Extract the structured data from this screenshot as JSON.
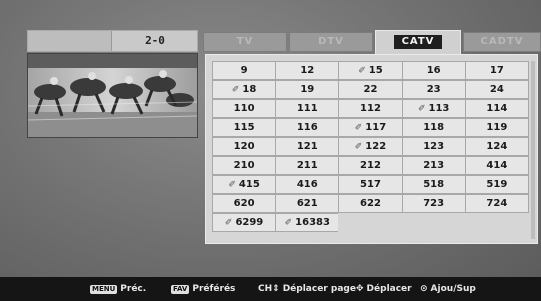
{
  "current_channel": "2-0",
  "tabs": [
    {
      "label": "TV",
      "active": false
    },
    {
      "label": "DTV",
      "active": false
    },
    {
      "label": "CATV",
      "active": true
    },
    {
      "label": "CADTV",
      "active": false
    }
  ],
  "channels": [
    [
      {
        "n": "9",
        "fav": false
      },
      {
        "n": "12",
        "fav": false
      },
      {
        "n": "15",
        "fav": true
      },
      {
        "n": "16",
        "fav": false
      },
      {
        "n": "17",
        "fav": false
      }
    ],
    [
      {
        "n": "18",
        "fav": true
      },
      {
        "n": "19",
        "fav": false
      },
      {
        "n": "22",
        "fav": false
      },
      {
        "n": "23",
        "fav": false
      },
      {
        "n": "24",
        "fav": false
      }
    ],
    [
      {
        "n": "110",
        "fav": false
      },
      {
        "n": "111",
        "fav": false
      },
      {
        "n": "112",
        "fav": false
      },
      {
        "n": "113",
        "fav": true
      },
      {
        "n": "114",
        "fav": false
      }
    ],
    [
      {
        "n": "115",
        "fav": false
      },
      {
        "n": "116",
        "fav": false
      },
      {
        "n": "117",
        "fav": true
      },
      {
        "n": "118",
        "fav": false
      },
      {
        "n": "119",
        "fav": false
      }
    ],
    [
      {
        "n": "120",
        "fav": false
      },
      {
        "n": "121",
        "fav": false
      },
      {
        "n": "122",
        "fav": true
      },
      {
        "n": "123",
        "fav": false
      },
      {
        "n": "124",
        "fav": false
      }
    ],
    [
      {
        "n": "210",
        "fav": false
      },
      {
        "n": "211",
        "fav": false
      },
      {
        "n": "212",
        "fav": false
      },
      {
        "n": "213",
        "fav": false
      },
      {
        "n": "414",
        "fav": false
      }
    ],
    [
      {
        "n": "415",
        "fav": true
      },
      {
        "n": "416",
        "fav": false
      },
      {
        "n": "517",
        "fav": false
      },
      {
        "n": "518",
        "fav": false
      },
      {
        "n": "519",
        "fav": false
      }
    ],
    [
      {
        "n": "620",
        "fav": false
      },
      {
        "n": "621",
        "fav": false
      },
      {
        "n": "622",
        "fav": false
      },
      {
        "n": "723",
        "fav": false
      },
      {
        "n": "724",
        "fav": false
      }
    ],
    [
      {
        "n": "6299",
        "fav": true
      },
      {
        "n": "16383",
        "fav": true
      }
    ]
  ],
  "favorite_icon": "wrench-icon",
  "footer": {
    "menu_key": "MENU",
    "menu_label": "Préc.",
    "fav_key": "FAV",
    "fav_label": "Préférés",
    "ch_key": "CH",
    "ch_label": "Déplacer page",
    "move_label": "Déplacer",
    "ok_label": "Ajou/Sup"
  }
}
